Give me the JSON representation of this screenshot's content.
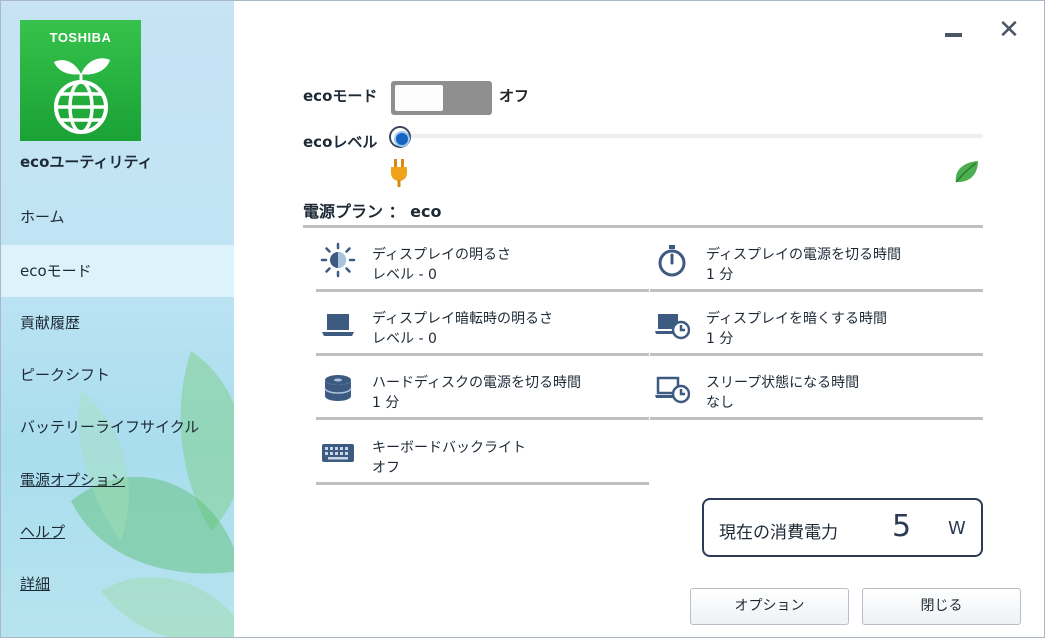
{
  "brand": {
    "logo_text": "TOSHIBA",
    "app_name": "ecoユーティリティ",
    "colors": {
      "logo_green": "#22ad3c",
      "sidebar_blue": "#bfe4f3",
      "accent_navy": "#2d3a55"
    }
  },
  "sidebar": {
    "items": [
      {
        "label": "ホーム",
        "active": false,
        "link": false
      },
      {
        "label": "ecoモード",
        "active": true,
        "link": false
      },
      {
        "label": "貢献履歴",
        "active": false,
        "link": false
      },
      {
        "label": "ピークシフト",
        "active": false,
        "link": false
      },
      {
        "label": "バッテリーライフサイクル",
        "active": false,
        "link": false
      },
      {
        "label": "電源オプション",
        "active": false,
        "link": true
      },
      {
        "label": "ヘルプ",
        "active": false,
        "link": true
      },
      {
        "label": "詳細",
        "active": false,
        "link": true
      }
    ]
  },
  "window": {
    "minimize_icon": "minimize-icon",
    "close_glyph": "✕"
  },
  "eco_mode": {
    "label": "ecoモード",
    "state": "オフ",
    "enabled": false
  },
  "eco_level": {
    "label": "ecoレベル",
    "level": 0,
    "left_icon": "plug-icon",
    "right_icon": "leaf-icon"
  },
  "power_plan": {
    "label": "電源プラン ： eco"
  },
  "settings": [
    {
      "icon": "brightness-icon",
      "title": "ディスプレイの明るさ",
      "value": "レベル - 0"
    },
    {
      "icon": "timer-icon",
      "title": "ディスプレイの電源を切る時間",
      "value": "1 分"
    },
    {
      "icon": "laptop-dim-icon",
      "title": "ディスプレイ暗転時の明るさ",
      "value": "レベル - 0"
    },
    {
      "icon": "laptop-clock-icon",
      "title": "ディスプレイを暗くする時間",
      "value": "1 分"
    },
    {
      "icon": "harddisk-icon",
      "title": "ハードディスクの電源を切る時間",
      "value": "1 分"
    },
    {
      "icon": "sleep-clock-icon",
      "title": "スリープ状態になる時間",
      "value": "なし"
    },
    {
      "icon": "keyboard-icon",
      "title": "キーボードバックライト",
      "value": "オフ"
    }
  ],
  "power_consumption": {
    "label": "現在の消費電力",
    "value": "5",
    "unit": "W"
  },
  "buttons": {
    "options": "オプション",
    "close": "閉じる"
  }
}
